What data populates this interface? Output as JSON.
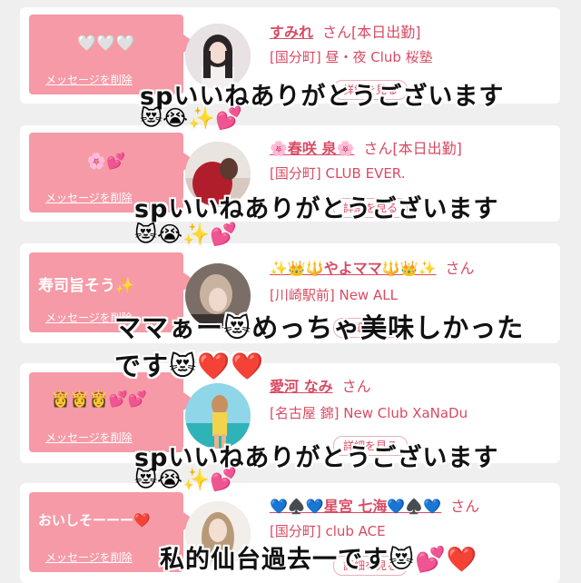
{
  "cards": [
    {
      "bubble_text": "🤍🤍🤍",
      "delete_label": "メッセージを削除",
      "name": "すみれ",
      "suffix": "さん[本日出勤]",
      "shop": "[国分町] 昼・夜 Club 桜塾",
      "view_label": "詳細を見る",
      "overlay_text": "spいいねありがとうございます",
      "overlay_emoji": "😻😭✨💕"
    },
    {
      "bubble_text": "🌸💕",
      "delete_label": "メッセージを削除",
      "name": "🌸春咲 泉🌸",
      "suffix": "さん[本日出勤]",
      "shop": "[国分町] CLUB EVER.",
      "view_label": "詳細を見る",
      "overlay_text": "spいいねありがとうございます",
      "overlay_emoji": "😻😭✨💕"
    },
    {
      "bubble_text": "寿司旨そう✨",
      "delete_label": "メッセージを削除",
      "name": "✨👑🔱やよママ🔱👑✨",
      "suffix": "さん",
      "shop": "[川崎駅前] New ALL",
      "view_label": "詳細を見る",
      "overlay_text": "ママぁー😻めっちゃ美味しかった",
      "overlay_text2": "です😻❤️❤️"
    },
    {
      "bubble_text": "👸👸👸💕💕",
      "delete_label": "メッセージを削除",
      "name": "愛河 なみ",
      "suffix": "さん",
      "shop": "[名古屋 錦] New Club XaNaDu",
      "view_label": "詳細を見る",
      "overlay_text": "spいいねありがとうございます",
      "overlay_emoji": "😻😭✨💕"
    },
    {
      "bubble_text": "おいしそーーー❤️",
      "delete_label": "メッセージを削除",
      "name": "💙♠️💙星宮 七海💙♠️💙",
      "suffix": "さん",
      "shop": "[国分町] club ACE",
      "view_label": "詳細を見る",
      "overlay_text": "私的仙台過去一です😻💕❤️"
    }
  ],
  "colors": {
    "accent": "#d84b63",
    "bubble": "#f59aa6",
    "background": "#efefef"
  }
}
